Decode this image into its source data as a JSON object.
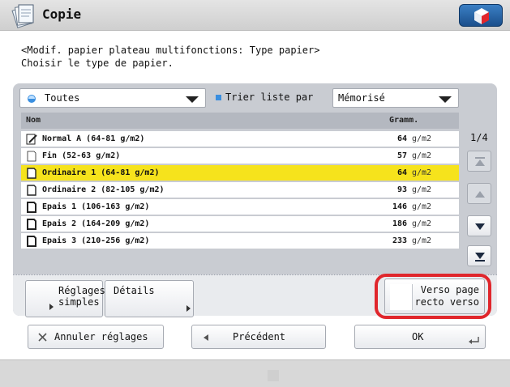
{
  "window": {
    "title": "Copie",
    "status_button_icon": "status-monitor-icon"
  },
  "instructions": {
    "line1": "<Modif. papier plateau multifonctions: Type papier>",
    "line2": "Choisir le type de papier."
  },
  "filter": {
    "selected": "Toutes",
    "sort_label": "Trier liste par",
    "sort_selected": "Mémorisé"
  },
  "list": {
    "columns": {
      "name": "Nom",
      "weight": "Gramm."
    },
    "rows": [
      {
        "name": "Normal A (64-81 g/m2)",
        "weight": "64",
        "unit": "g/m2",
        "icon": "edit-paper-icon",
        "selected": false
      },
      {
        "name": "Fin (52-63 g/m2)",
        "weight": "57",
        "unit": "g/m2",
        "icon": "paper-thin-icon",
        "selected": false
      },
      {
        "name": "Ordinaire 1 (64-81 g/m2)",
        "weight": "64",
        "unit": "g/m2",
        "icon": "paper-icon",
        "selected": true
      },
      {
        "name": "Ordinaire 2 (82-105 g/m2)",
        "weight": "93",
        "unit": "g/m2",
        "icon": "paper-icon",
        "selected": false
      },
      {
        "name": "Epais 1 (106-163 g/m2)",
        "weight": "146",
        "unit": "g/m2",
        "icon": "paper-thick-icon",
        "selected": false
      },
      {
        "name": "Epais 2 (164-209 g/m2)",
        "weight": "186",
        "unit": "g/m2",
        "icon": "paper-thick-icon",
        "selected": false
      },
      {
        "name": "Epais 3 (210-256 g/m2)",
        "weight": "233",
        "unit": "g/m2",
        "icon": "paper-thick-icon",
        "selected": false
      }
    ],
    "page": "1/4"
  },
  "panel_buttons": {
    "simple_settings": "Réglages\nsimples",
    "simple_line1": "Réglages",
    "simple_line2": "simples",
    "details": "Détails",
    "duplex_line1": "Verso page",
    "duplex_line2": "recto verso"
  },
  "footer": {
    "cancel": "Annuler réglages",
    "back": "Précédent",
    "ok": "OK"
  },
  "colors": {
    "selection": "#f6e31c",
    "highlight_ring": "#e0262c",
    "panel": "#c9ccd2"
  }
}
